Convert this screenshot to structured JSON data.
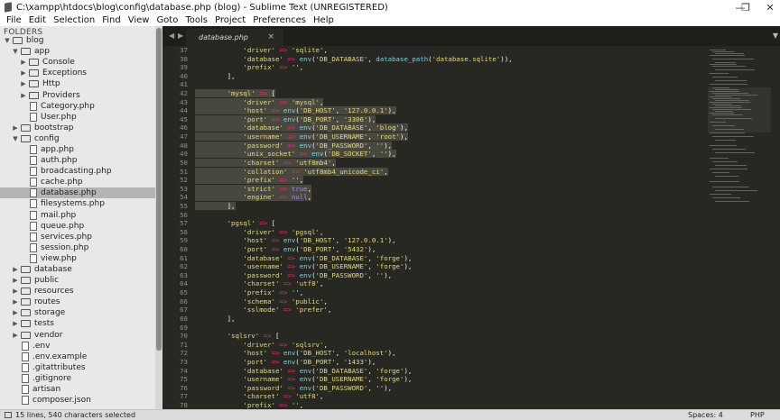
{
  "window": {
    "title": "C:\\xampp\\htdocs\\blog\\config\\database.php (blog) - Sublime Text (UNREGISTERED)",
    "minimize": "—",
    "maximize": "❐",
    "close": "✕"
  },
  "menu": [
    "File",
    "Edit",
    "Selection",
    "Find",
    "View",
    "Goto",
    "Tools",
    "Project",
    "Preferences",
    "Help"
  ],
  "sidebar": {
    "header": "FOLDERS",
    "tree": [
      {
        "label": "blog",
        "kind": "folder",
        "open": true,
        "depth": 0
      },
      {
        "label": "app",
        "kind": "folder",
        "open": true,
        "depth": 1
      },
      {
        "label": "Console",
        "kind": "folder",
        "open": false,
        "depth": 2
      },
      {
        "label": "Exceptions",
        "kind": "folder",
        "open": false,
        "depth": 2
      },
      {
        "label": "Http",
        "kind": "folder",
        "open": false,
        "depth": 2
      },
      {
        "label": "Providers",
        "kind": "folder",
        "open": false,
        "depth": 2
      },
      {
        "label": "Category.php",
        "kind": "file",
        "depth": 2
      },
      {
        "label": "User.php",
        "kind": "file",
        "depth": 2
      },
      {
        "label": "bootstrap",
        "kind": "folder",
        "open": false,
        "depth": 1
      },
      {
        "label": "config",
        "kind": "folder",
        "open": true,
        "depth": 1
      },
      {
        "label": "app.php",
        "kind": "file",
        "depth": 2
      },
      {
        "label": "auth.php",
        "kind": "file",
        "depth": 2
      },
      {
        "label": "broadcasting.php",
        "kind": "file",
        "depth": 2
      },
      {
        "label": "cache.php",
        "kind": "file",
        "depth": 2
      },
      {
        "label": "database.php",
        "kind": "file",
        "depth": 2,
        "selected": true
      },
      {
        "label": "filesystems.php",
        "kind": "file",
        "depth": 2
      },
      {
        "label": "mail.php",
        "kind": "file",
        "depth": 2
      },
      {
        "label": "queue.php",
        "kind": "file",
        "depth": 2
      },
      {
        "label": "services.php",
        "kind": "file",
        "depth": 2
      },
      {
        "label": "session.php",
        "kind": "file",
        "depth": 2
      },
      {
        "label": "view.php",
        "kind": "file",
        "depth": 2
      },
      {
        "label": "database",
        "kind": "folder",
        "open": false,
        "depth": 1
      },
      {
        "label": "public",
        "kind": "folder",
        "open": false,
        "depth": 1
      },
      {
        "label": "resources",
        "kind": "folder",
        "open": false,
        "depth": 1
      },
      {
        "label": "routes",
        "kind": "folder",
        "open": false,
        "depth": 1
      },
      {
        "label": "storage",
        "kind": "folder",
        "open": false,
        "depth": 1
      },
      {
        "label": "tests",
        "kind": "folder",
        "open": false,
        "depth": 1
      },
      {
        "label": "vendor",
        "kind": "folder",
        "open": false,
        "depth": 1
      },
      {
        "label": ".env",
        "kind": "file",
        "depth": 1
      },
      {
        "label": ".env.example",
        "kind": "file",
        "depth": 1
      },
      {
        "label": ".gitattributes",
        "kind": "file",
        "depth": 1
      },
      {
        "label": ".gitignore",
        "kind": "file",
        "depth": 1
      },
      {
        "label": "artisan",
        "kind": "file",
        "depth": 1
      },
      {
        "label": "composer.json",
        "kind": "file",
        "depth": 1
      }
    ]
  },
  "editor": {
    "tab_label": "database.php",
    "tab_close": "×",
    "nav_prev": "◀",
    "nav_next": "▶",
    "tab_menu": "▼",
    "lines": [
      {
        "n": 37,
        "text": "            'driver' => 'sqlite',"
      },
      {
        "n": 38,
        "text": "            'database' => env('DB_DATABASE', database_path('database.sqlite')),"
      },
      {
        "n": 39,
        "text": "            'prefix' => '',"
      },
      {
        "n": 40,
        "text": "        ],"
      },
      {
        "n": 41,
        "text": ""
      },
      {
        "n": 42,
        "text": "        'mysql' => [",
        "sel": true
      },
      {
        "n": 43,
        "text": "            'driver' => 'mysql',",
        "sel": true
      },
      {
        "n": 44,
        "text": "            'host' => env('DB_HOST', '127.0.0.1'),",
        "sel": true
      },
      {
        "n": 45,
        "text": "            'port' => env('DB_PORT', '3306'),",
        "sel": true
      },
      {
        "n": 46,
        "text": "            'database' => env('DB_DATABASE', 'blog'),",
        "sel": true
      },
      {
        "n": 47,
        "text": "            'username' => env('DB_USERNAME', 'root'),",
        "sel": true
      },
      {
        "n": 48,
        "text": "            'password' => env('DB_PASSWORD', ''),",
        "sel": true
      },
      {
        "n": 49,
        "text": "            'unix_socket' => env('DB_SOCKET', ''),",
        "sel": true
      },
      {
        "n": 50,
        "text": "            'charset' => 'utf8mb4',",
        "sel": true
      },
      {
        "n": 51,
        "text": "            'collation' => 'utf8mb4_unicode_ci',",
        "sel": true
      },
      {
        "n": 52,
        "text": "            'prefix' => '',",
        "sel": true
      },
      {
        "n": 53,
        "text": "            'strict' => true,",
        "sel": true
      },
      {
        "n": 54,
        "text": "            'engine' => null,",
        "sel": true
      },
      {
        "n": 55,
        "text": "        ],",
        "sel": true
      },
      {
        "n": 56,
        "text": ""
      },
      {
        "n": 57,
        "text": "        'pgsql' => ["
      },
      {
        "n": 58,
        "text": "            'driver' => 'pgsql',"
      },
      {
        "n": 59,
        "text": "            'host' => env('DB_HOST', '127.0.0.1'),"
      },
      {
        "n": 60,
        "text": "            'port' => env('DB_PORT', '5432'),"
      },
      {
        "n": 61,
        "text": "            'database' => env('DB_DATABASE', 'forge'),"
      },
      {
        "n": 62,
        "text": "            'username' => env('DB_USERNAME', 'forge'),"
      },
      {
        "n": 63,
        "text": "            'password' => env('DB_PASSWORD', ''),"
      },
      {
        "n": 64,
        "text": "            'charset' => 'utf8',"
      },
      {
        "n": 65,
        "text": "            'prefix' => '',"
      },
      {
        "n": 66,
        "text": "            'schema' => 'public',"
      },
      {
        "n": 67,
        "text": "            'sslmode' => 'prefer',"
      },
      {
        "n": 68,
        "text": "        ],"
      },
      {
        "n": 69,
        "text": ""
      },
      {
        "n": 70,
        "text": "        'sqlsrv' => ["
      },
      {
        "n": 71,
        "text": "            'driver' => 'sqlsrv',"
      },
      {
        "n": 72,
        "text": "            'host' => env('DB_HOST', 'localhost'),"
      },
      {
        "n": 73,
        "text": "            'port' => env('DB_PORT', '1433'),"
      },
      {
        "n": 74,
        "text": "            'database' => env('DB_DATABASE', 'forge'),"
      },
      {
        "n": 75,
        "text": "            'username' => env('DB_USERNAME', 'forge'),"
      },
      {
        "n": 76,
        "text": "            'password' => env('DB_PASSWORD', ''),"
      },
      {
        "n": 77,
        "text": "            'charset' => 'utf8',"
      },
      {
        "n": 78,
        "text": "            'prefix' => '',"
      }
    ]
  },
  "status": {
    "selection": "15 lines, 540 characters selected",
    "spaces": "Spaces: 4",
    "syntax": "PHP"
  },
  "colors": {
    "editor_bg": "#272822",
    "string": "#e6db74",
    "operator": "#f92672",
    "function": "#66d9ef",
    "constant": "#ae81ff",
    "selection": "#49483e",
    "sidebar_bg": "#e8e8e8",
    "sidebar_selected": "#b4b4b4"
  }
}
